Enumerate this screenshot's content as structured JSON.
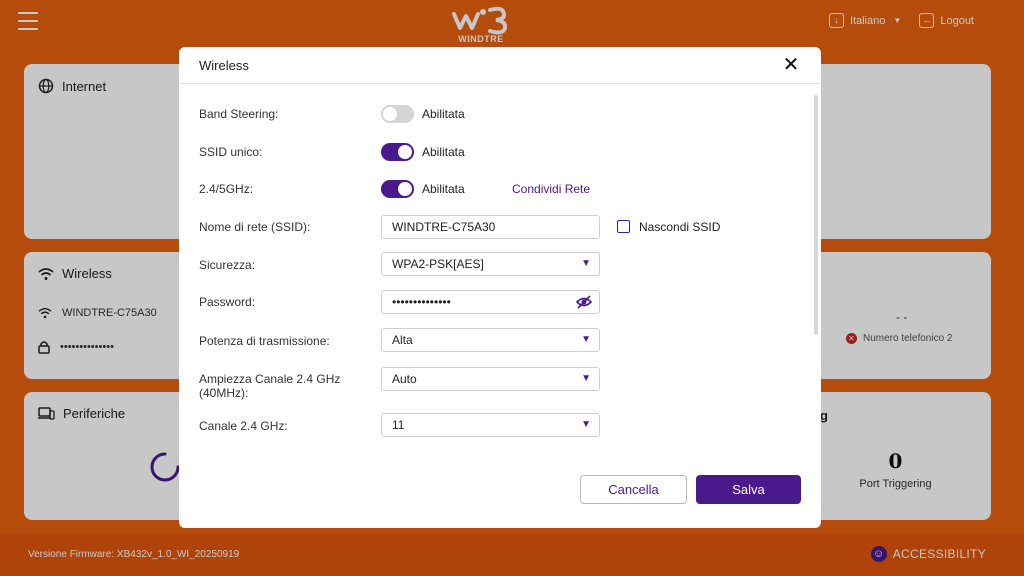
{
  "header": {
    "brand": "WINDTRE",
    "language": "Italiano",
    "logout": "Logout"
  },
  "background": {
    "internet_title": "Internet",
    "wireless_title": "Wireless",
    "wireless_ssid": "WINDTRE-C75A30",
    "wireless_password": "••••••••••••••",
    "devices_title": "Periferiche",
    "dash_value": "- -",
    "phone_status": "Numero telefonico 2",
    "port_title_fragment": "g",
    "port_count": "0",
    "port_label": "Port Triggering"
  },
  "footer": {
    "firmware": "Versione Firmware: XB432v_1.0_WI_20250919",
    "accessibility": "ACCESSIBILITY"
  },
  "modal": {
    "title": "Wireless",
    "band_steering_label": "Band Steering:",
    "band_steering_state": "Abilitata",
    "ssid_unico_label": "SSID unico:",
    "ssid_unico_state": "Abilitata",
    "dual_band_label": "2.4/5GHz:",
    "dual_band_state": "Abilitata",
    "share_network": "Condividi Rete",
    "ssid_label": "Nome di rete (SSID):",
    "ssid_value": "WINDTRE-C75A30",
    "hide_ssid_label": "Nascondi SSID",
    "security_label": "Sicurezza:",
    "security_value": "WPA2-PSK[AES]",
    "password_label": "Password:",
    "password_value": "••••••••••••••",
    "power_label": "Potenza di trasmissione:",
    "power_value": "Alta",
    "bandwidth_label_line1": "Ampiezza Canale 2.4 GHz",
    "bandwidth_label_line2": "(40MHz):",
    "bandwidth_value": "Auto",
    "channel_label": "Canale 2.4 GHz:",
    "channel_value": "11",
    "cancel": "Cancella",
    "save": "Salva"
  },
  "states": {
    "band_steering_enabled": false,
    "ssid_unico_enabled": true,
    "dual_band_enabled": true,
    "hide_ssid_checked": false
  },
  "colors": {
    "brand_orange": "#e8620f",
    "accent_purple": "#4a1a8c"
  },
  "icons": [
    "hamburger-icon",
    "globe-icon",
    "wifi-icon",
    "lock-icon",
    "devices-icon",
    "eye-off-icon",
    "close-icon",
    "chevron-down-icon",
    "accessibility-icon",
    "logout-icon",
    "language-icon",
    "error-icon"
  ]
}
